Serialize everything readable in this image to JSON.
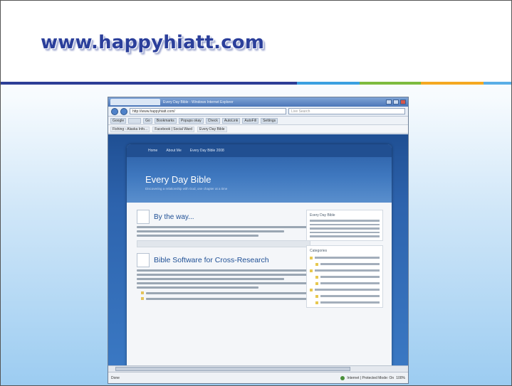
{
  "slide": {
    "title": "www.happyhiatt.com"
  },
  "browser": {
    "window_title": "Every Day Bible - Windows Internet Explorer",
    "url": "http://www.happyhiatt.com/",
    "search_placeholder": "Live Search",
    "toolbar_buttons": [
      "Google",
      "Go",
      "Bookmarks",
      "Popups okay",
      "Check",
      "AutoLink",
      "AutoFill",
      "Settings"
    ],
    "favorites": [
      "Fishing - Alaska Info...",
      "Facebook | Social Ward",
      "Every Day Bible"
    ],
    "status_text": "Done",
    "status_zone": "Internet | Protected Mode: On",
    "zoom": "100%"
  },
  "blog": {
    "nav": [
      "Home",
      "About Me",
      "Every Day Bible 2008"
    ],
    "title": "Every Day Bible",
    "tagline": "Discovering a relationship with God, one chapter at a time",
    "posts": [
      {
        "title": "By the way..."
      },
      {
        "title": "Bible Software for Cross-Research"
      }
    ],
    "sidebar": {
      "about_title": "Every Day Bible",
      "categories_title": "Categories"
    }
  },
  "colors": {
    "title_text": "#2b3f9b",
    "accent_dark_blue": "#2c3e96",
    "accent_light_blue": "#3aa0e0",
    "accent_green": "#7dbb3f",
    "accent_orange": "#f4a821"
  }
}
